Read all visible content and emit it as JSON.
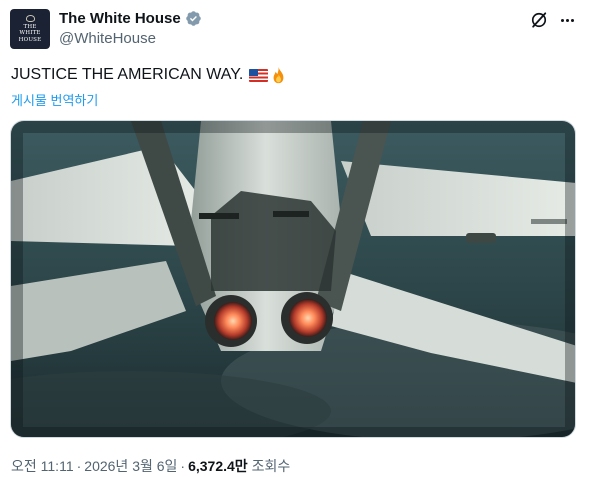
{
  "author": {
    "display_name": "The White House",
    "handle": "@WhiteHouse",
    "avatar_text_line1": "THE",
    "avatar_text_line2": "WHITE",
    "avatar_text_line3": "HOUSE",
    "verified_icon": "verified-badge-icon",
    "verified_color": "#829aab"
  },
  "actions": {
    "grok_icon": "grok-icon",
    "more_icon": "more-horizontal-icon"
  },
  "tweet": {
    "text": "JUSTICE THE AMERICAN WAY.",
    "emoji_1": "us-flag-icon",
    "emoji_2": "fire-icon",
    "translate_label": "게시물 번역하기"
  },
  "media": {
    "type": "video",
    "icon": "fighter-jet-video-frame"
  },
  "meta": {
    "time": "오전 11:11",
    "separator": "·",
    "date": "2026년 3월 6일",
    "views_count": "6,372.4만",
    "views_label": "조회수"
  },
  "colors": {
    "text": "#0f1419",
    "secondary": "#536471",
    "link": "#1d9bf0"
  }
}
